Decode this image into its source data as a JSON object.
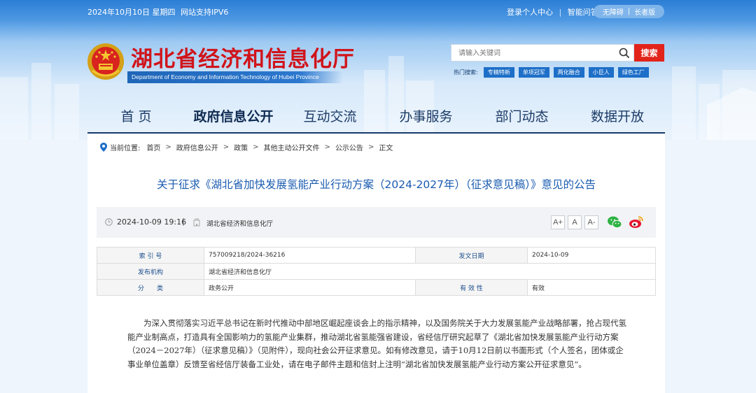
{
  "topbar": {
    "date": "2024年10月10日 星期四",
    "ipv6": "网站支持IPV6",
    "login": "登录个人中心",
    "qa": "智能问答",
    "accessible": "无障碍",
    "elderly": "长者版"
  },
  "site": {
    "title": "湖北省经济和信息化厅",
    "subtitle": "Department of Economy and Information Technology of Hubei Province"
  },
  "search": {
    "placeholder": "请输入关键词",
    "button": "搜索",
    "hot_label": "热门搜索:",
    "hot_tags": [
      "专精特新",
      "单项冠军",
      "两化融合",
      "小巨人",
      "绿色工厂"
    ]
  },
  "nav": {
    "items": [
      "首 页",
      "政府信息公开",
      "互动交流",
      "办事服务",
      "部门动态",
      "数据开放"
    ]
  },
  "breadcrumb": {
    "label": "当前位置:",
    "items": [
      "首页",
      "政府信息公开",
      "政策",
      "其他主动公开文件",
      "公示公告",
      "正文"
    ]
  },
  "article": {
    "title": "关于征求《湖北省加快发展氢能产业行动方案（2024-2027年）（征求意见稿）》意见的公告",
    "date": "2024-10-09 19:16",
    "separator": "|",
    "source": "湖北省经济和信息化厅",
    "font_buttons": [
      "A+",
      "A",
      "A-"
    ],
    "body": "为深入贯彻落实习近平总书记在新时代推动中部地区崛起座谈会上的指示精神，以及国务院关于大力发展氢能产业战略部署，抢占现代氢能产业制高点，打造具有全国影响力的氢能产业集群，推动湖北省氢能强省建设，省经信厅研究起草了《湖北省加快发展氢能产业行动方案（2024－2027年）（征求意见稿）》（见附件），现向社会公开征求意见。如有修改意见，请于10月12日前以书面形式（个人签名，团体或企事业单位盖章）反馈至省经信厅装备工业处，请在电子邮件主题和信封上注明“湖北省加快发展氢能产业行动方案公开征求意见”。"
  },
  "info_table": {
    "index_label": "索 引 号",
    "index_value": "757009218/2024-36216",
    "date_label": "发文日期",
    "date_value": "2024-10-09",
    "org_label": "发布机构",
    "org_value": "湖北省经济和信息化厅",
    "category_label": "分　　类",
    "category_value": "政务公开",
    "validity_label": "有 效 性",
    "validity_value": "有效"
  },
  "colors": {
    "brand_red": "#d0141b",
    "header_blue": "#2c7ed6",
    "title_blue": "#1a5bb0",
    "tag_blue": "#1e6fc8"
  },
  "icons": [
    "national-emblem-icon",
    "search-icon",
    "location-pin-icon",
    "clock-icon",
    "building-icon",
    "wechat-icon",
    "weibo-icon"
  ]
}
